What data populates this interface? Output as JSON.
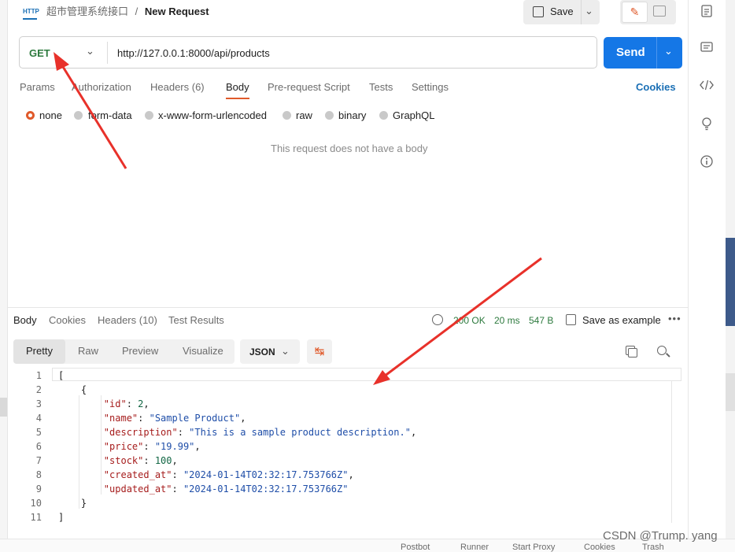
{
  "header": {
    "collection": "超市管理系统接口",
    "separator": "/",
    "request_name": "New Request",
    "save_label": "Save",
    "http_badge": "HTTP"
  },
  "request": {
    "method": "GET",
    "url": "http://127.0.0.1:8000/api/products",
    "send_label": "Send"
  },
  "tabs": [
    "Params",
    "Authorization",
    "Headers (6)",
    "Body",
    "Pre-request Script",
    "Tests",
    "Settings"
  ],
  "active_tab": "Body",
  "cookies_label": "Cookies",
  "body_options": [
    "none",
    "form-data",
    "x-www-form-urlencoded",
    "raw",
    "binary",
    "GraphQL"
  ],
  "selected_body_option": "none",
  "no_body_text": "This request does not have a body",
  "response": {
    "tabs": [
      "Body",
      "Cookies",
      "Headers (10)",
      "Test Results"
    ],
    "status": "200 OK",
    "time": "20 ms",
    "size": "547 B",
    "save_example": "Save as example",
    "view_modes": [
      "Pretty",
      "Raw",
      "Preview",
      "Visualize"
    ],
    "format": "JSON",
    "line_numbers": [
      "1",
      "2",
      "3",
      "4",
      "5",
      "6",
      "7",
      "8",
      "9",
      "10",
      "11"
    ],
    "json": {
      "id": "2",
      "name": "\"Sample Product\"",
      "description": "\"This is a sample product description.\"",
      "price": "\"19.99\"",
      "stock": "100",
      "created_at": "\"2024-01-14T02:32:17.753766Z\"",
      "updated_at": "\"2024-01-14T02:32:17.753766Z\""
    }
  },
  "status_bar": [
    "Postbot",
    "Runner",
    "Start Proxy",
    "Cookies",
    "Trash"
  ],
  "watermark": "CSDN @Trump. yang",
  "colors": {
    "accent": "#e05a2b",
    "send": "#1577e6",
    "get_method": "#2d7a3e",
    "arrow": "#e8312a"
  }
}
